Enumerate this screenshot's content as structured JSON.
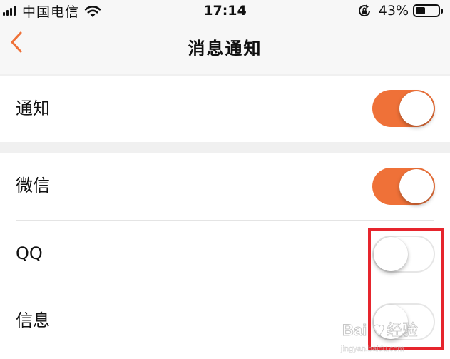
{
  "status_bar": {
    "carrier": "中国电信",
    "time": "17:14",
    "battery_percent": "43%",
    "battery_level": 0.43,
    "icons": [
      "signal-bars-icon",
      "wifi-icon",
      "rotation-lock-icon",
      "battery-icon"
    ]
  },
  "nav": {
    "title": "消息通知",
    "back_icon": "chevron-left-icon",
    "accent_color": "#ef7138"
  },
  "sections": [
    {
      "items": [
        {
          "label": "通知",
          "toggle_on": true
        }
      ]
    },
    {
      "items": [
        {
          "label": "微信",
          "toggle_on": true
        },
        {
          "label": "QQ",
          "toggle_on": false
        },
        {
          "label": "信息",
          "toggle_on": false
        }
      ]
    }
  ],
  "colors": {
    "toggle_on": "#ef7138",
    "toggle_off_border": "#e6e6e6",
    "highlight_box": "#e6252d",
    "background": "#f0f0f0"
  },
  "watermark": {
    "logo_text": "Bai经验",
    "url_text": "jingyan.baidu.com"
  }
}
